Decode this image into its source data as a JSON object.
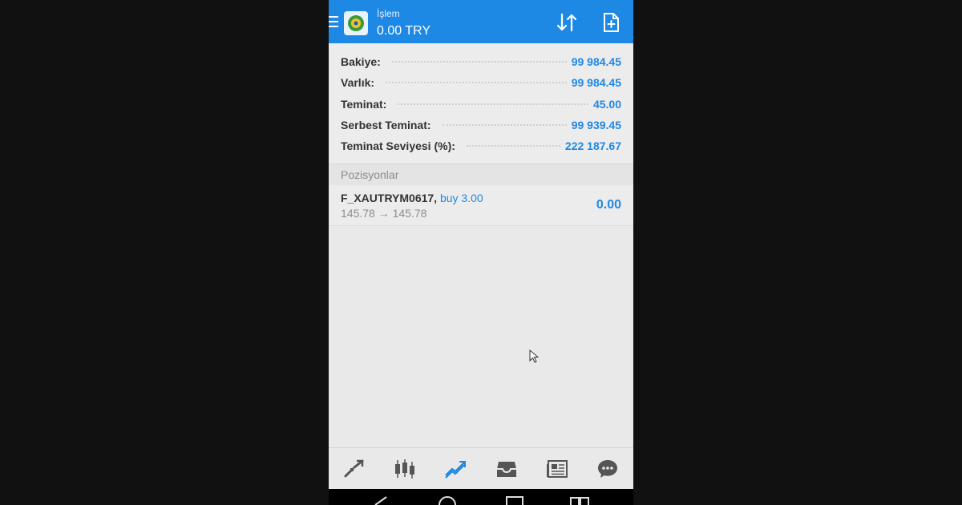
{
  "header": {
    "subtitle": "İşlem",
    "balance_title": "0.00 TRY"
  },
  "account": {
    "rows": [
      {
        "label": "Bakiye:",
        "value": "99 984.45"
      },
      {
        "label": "Varlık:",
        "value": "99 984.45"
      },
      {
        "label": "Teminat:",
        "value": "45.00"
      },
      {
        "label": "Serbest Teminat:",
        "value": "99 939.45"
      },
      {
        "label": "Teminat Seviyesi (%):",
        "value": "222 187.67"
      }
    ]
  },
  "positions": {
    "header": "Pozisyonlar",
    "items": [
      {
        "symbol": "F_XAUTRYM0617,",
        "type": "buy 3.00",
        "prices": "145.78 → 145.78",
        "profit": "0.00"
      }
    ]
  },
  "bottom_nav": {
    "items": [
      {
        "icon": "quotes-icon"
      },
      {
        "icon": "chart-icon"
      },
      {
        "icon": "trade-icon",
        "active": true
      },
      {
        "icon": "history-icon"
      },
      {
        "icon": "news-icon"
      },
      {
        "icon": "chat-icon"
      }
    ]
  },
  "colors": {
    "accent": "#1e88e5",
    "background": "#e9e9e9",
    "label": "#333333",
    "muted": "#8c8c8c"
  }
}
